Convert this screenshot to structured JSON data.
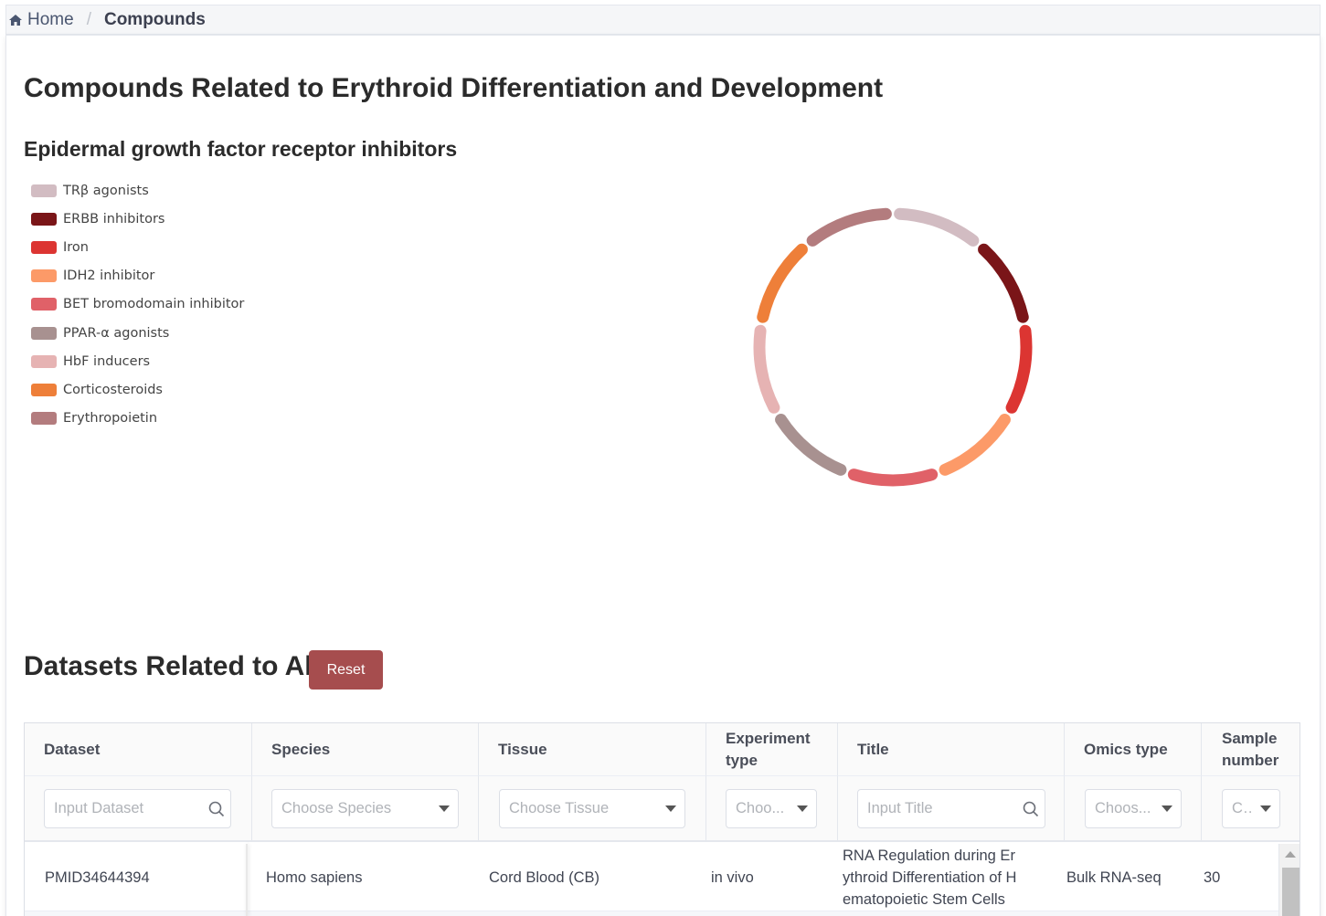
{
  "breadcrumb": {
    "home": "Home",
    "separator": "/",
    "current": "Compounds"
  },
  "page_title": "Compounds Related to Erythroid Differentiation and Development",
  "chart_title": "Epidermal growth factor receptor inhibitors",
  "chart_data": {
    "type": "pie",
    "title": "Epidermal growth factor receptor inhibitors",
    "legend_position": "left",
    "slices": [
      {
        "label": "TRβ agonists",
        "value": 1,
        "color": "#d2bcc2"
      },
      {
        "label": "ERBB inhibitors",
        "value": 1,
        "color": "#7a1518"
      },
      {
        "label": "Iron",
        "value": 1,
        "color": "#dc3532"
      },
      {
        "label": "IDH2 inhibitor",
        "value": 1,
        "color": "#fc9a68"
      },
      {
        "label": "BET bromodomain inhibitor",
        "value": 1,
        "color": "#e06168"
      },
      {
        "label": "PPAR-α agonists",
        "value": 1,
        "color": "#a89190"
      },
      {
        "label": "HbF inducers",
        "value": 1,
        "color": "#e6b3b3"
      },
      {
        "label": "Corticosteroids",
        "value": 1,
        "color": "#ee7f39"
      },
      {
        "label": "Erythropoietin",
        "value": 1,
        "color": "#b37c7e"
      }
    ]
  },
  "datasets": {
    "title": "Datasets Related to All",
    "reset_label": "Reset",
    "columns": [
      "Dataset",
      "Species",
      "Tissue",
      "Experiment type",
      "Title",
      "Omics type",
      "Sample number"
    ],
    "filters": [
      {
        "placeholder": "Input Dataset",
        "kind": "search"
      },
      {
        "placeholder": "Choose Species",
        "kind": "select"
      },
      {
        "placeholder": "Choose Tissue",
        "kind": "select"
      },
      {
        "placeholder": "Choo...",
        "kind": "select"
      },
      {
        "placeholder": "Input Title",
        "kind": "search"
      },
      {
        "placeholder": "Choos...",
        "kind": "select"
      },
      {
        "placeholder": "C...",
        "kind": "select"
      }
    ],
    "rows": [
      {
        "dataset": "PMID34644394",
        "species": "Homo sapiens",
        "tissue": "Cord Blood (CB)",
        "experiment_type": "in vivo",
        "title_lines": [
          "RNA Regulation during Er",
          "ythroid Differentiation of H",
          "ematopoietic Stem Cells"
        ],
        "omics_type": "Bulk RNA-seq",
        "sample_number": "30"
      }
    ]
  }
}
